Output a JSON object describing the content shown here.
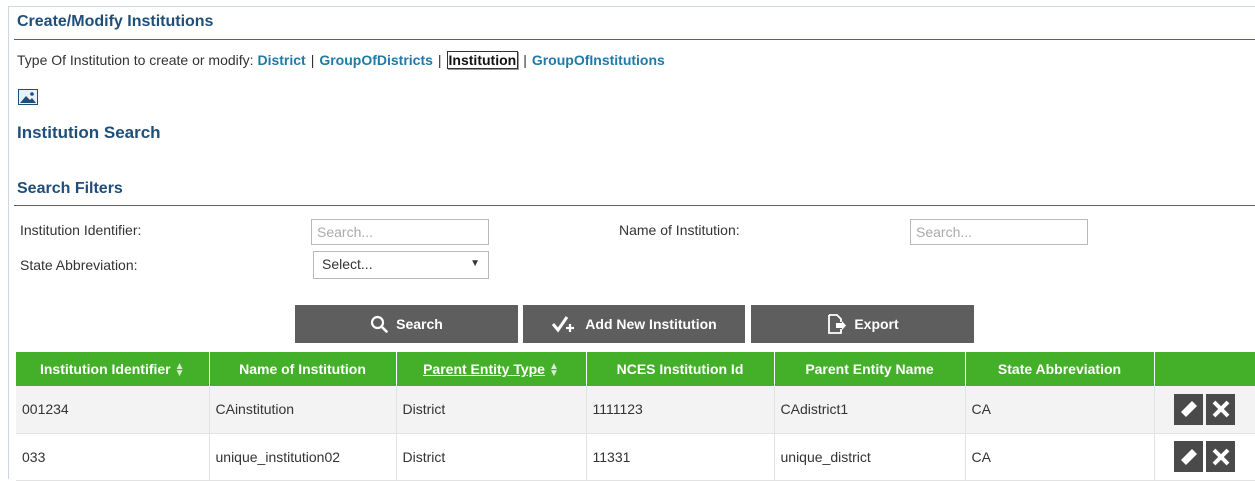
{
  "page": {
    "title": "Create/Modify Institutions",
    "type_prompt": "Type Of Institution to create or modify:",
    "type_links": [
      {
        "label": "District",
        "active": false
      },
      {
        "label": "GroupOfDistricts",
        "active": false
      },
      {
        "label": "Institution",
        "active": true
      },
      {
        "label": "GroupOfInstitutions",
        "active": false
      }
    ],
    "image_icon": "image-icon",
    "section_title": "Institution Search"
  },
  "filters": {
    "title": "Search Filters",
    "institution_identifier_label": "Institution Identifier:",
    "institution_identifier_placeholder": "Search...",
    "name_label": "Name of Institution:",
    "name_placeholder": "Search...",
    "state_label": "State Abbreviation:",
    "state_selected": "Select..."
  },
  "actions": {
    "search_label": "Search",
    "add_label": "Add New Institution",
    "export_label": "Export"
  },
  "table": {
    "columns": [
      "Institution Identifier",
      "Name of Institution",
      "Parent Entity Type",
      "NCES Institution Id",
      "Parent Entity Name",
      "State Abbreviation"
    ],
    "rows": [
      [
        "001234",
        "CAinstitution",
        "District",
        "1111123",
        "CAdistrict1",
        "CA"
      ],
      [
        "033",
        "unique_institution02",
        "District",
        "11331",
        "unique_district",
        "CA"
      ]
    ]
  },
  "colors": {
    "header_green": "#44b02a",
    "title_blue": "#1f4e79",
    "link_blue": "#1f7aa8",
    "button_gray": "#5e5e5e"
  }
}
